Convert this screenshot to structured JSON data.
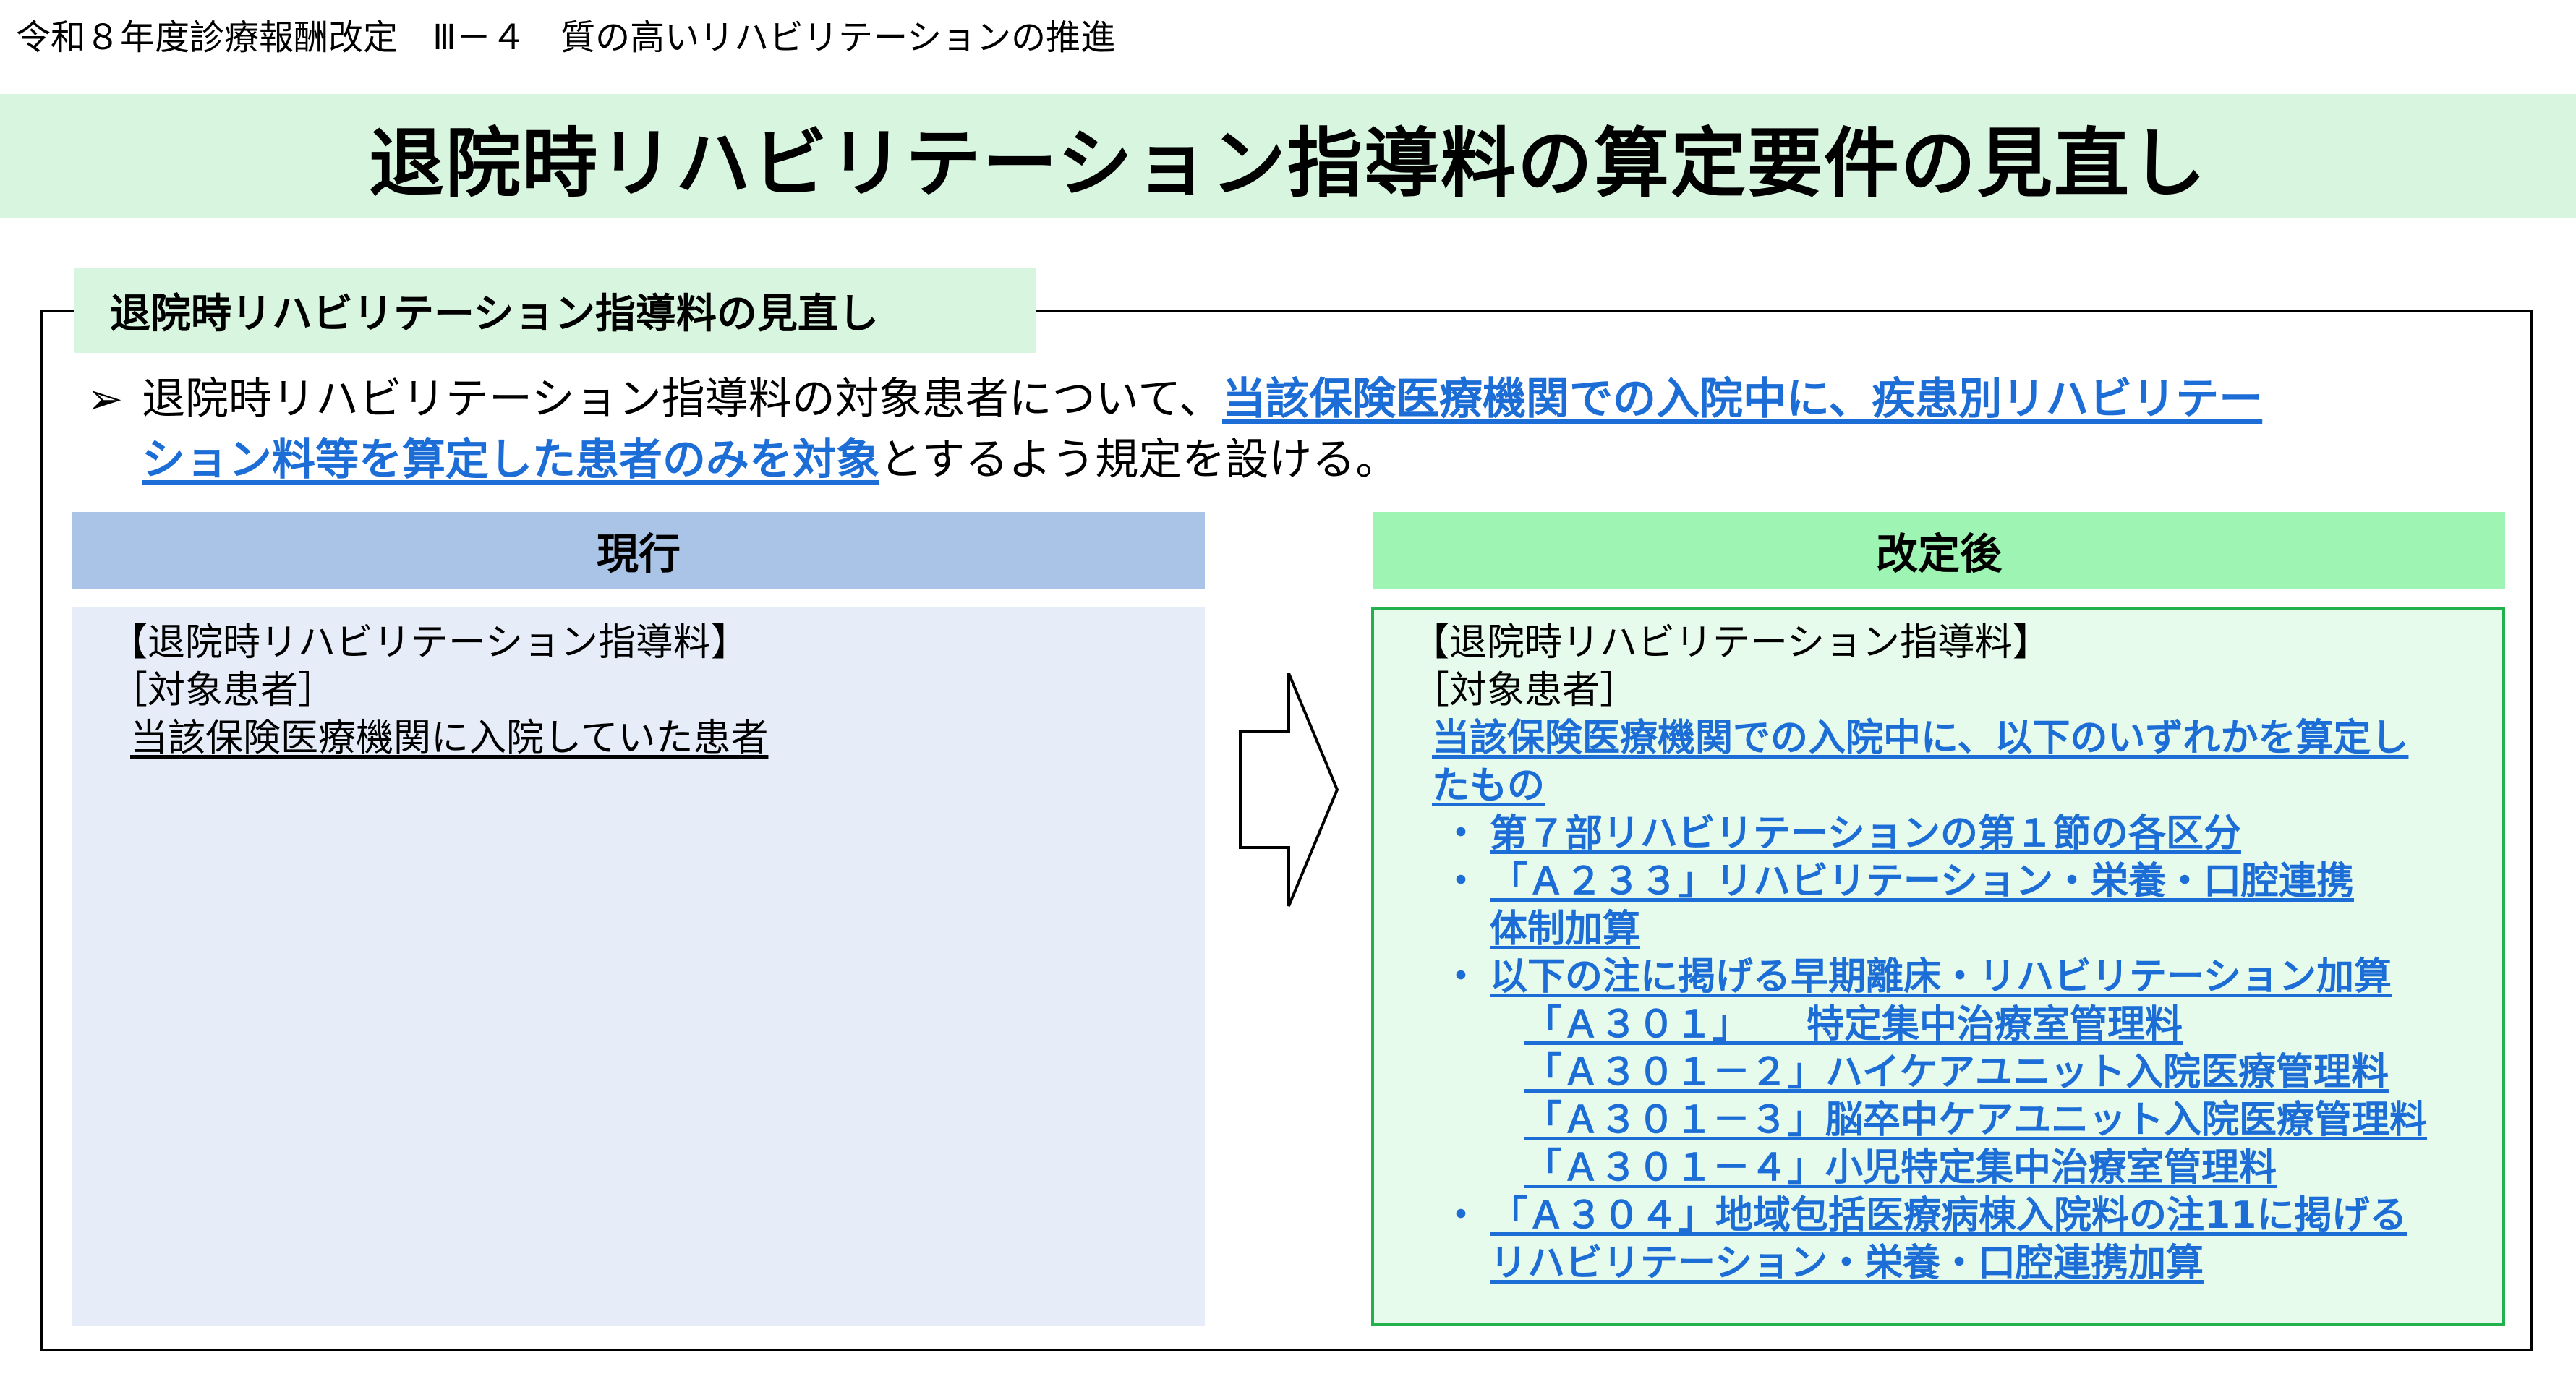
{
  "header": {
    "caption": "令和８年度診療報酬改定　Ⅲ－４　質の高いリハビリテーションの推進"
  },
  "title": "退院時リハビリテーション指導料の算定要件の見直し",
  "section": {
    "tab_label": "退院時リハビリテーション指導料の見直し",
    "marker": "➢",
    "lead_part1": "退院時リハビリテーション指導料の対象患者について、",
    "lead_highlight1": "当該保険医療機関での入院中に、疾患別リハビリテー",
    "lead_highlight2": "ション料等を算定した患者のみを対象",
    "lead_part2": "とするよう規定を設ける。"
  },
  "current": {
    "header": "現行",
    "line1": "【退院時リハビリテーション指導料】",
    "line2": "［対象患者］",
    "line3": "当該保険医療機関に入院していた患者"
  },
  "revised": {
    "header": "改定後",
    "line1": "【退院時リハビリテーション指導料】",
    "line2": "［対象患者］",
    "intro1": "当該保険医療機関での入院中に、以下のいずれかを算定し",
    "intro2": "たもの",
    "bullet_symbol": "・",
    "bullet1": "第７部リハビリテーションの第１節の各区分",
    "bullet2a": "「Ａ２３３」リハビリテーション・栄養・口腔連携",
    "bullet2b": "体制加算",
    "bullet3": "以下の注に掲げる早期離床・リハビリテーション加算",
    "sub1": "「Ａ３０１」　　特定集中治療室管理料",
    "sub2": "「Ａ３０１－２」ハイケアユニット入院医療管理料",
    "sub3": "「Ａ３０１－３」脳卒中ケアユニット入院医療管理料",
    "sub4": "「Ａ３０１－４」小児特定集中治療室管理料",
    "bullet4a": "「Ａ３０４」地域包括医療病棟入院料の注11に掲げる",
    "bullet4b": "リハビリテーション・栄養・口腔連携加算"
  },
  "colors": {
    "title_band": "#d8f6df",
    "current_header": "#a9c4e6",
    "current_body": "#e6edf8",
    "revised_header": "#9ef5b3",
    "revised_body": "#e6fbec",
    "revised_border": "#22b14c",
    "highlight_text": "#1c6ed6"
  },
  "icons": {
    "transition_arrow": "right-arrow-icon"
  }
}
